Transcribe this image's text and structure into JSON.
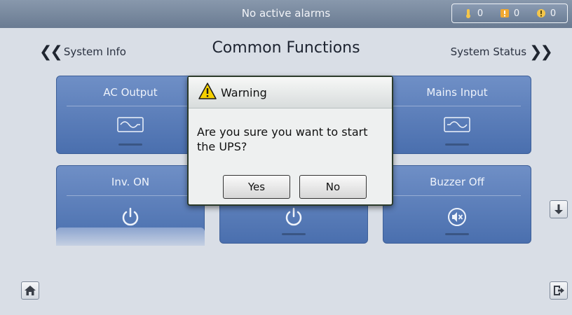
{
  "alarm_bar": {
    "title": "No active alarms",
    "counts": {
      "minor": "0",
      "major": "0",
      "critical": "0"
    }
  },
  "nav": {
    "left_label": "System Info",
    "right_label": "System Status",
    "page_title": "Common Functions"
  },
  "tiles": {
    "ac_output": {
      "label": "AC Output",
      "icon": "sine-wave-icon"
    },
    "mains_input": {
      "label": "Mains Input",
      "icon": "sine-wave-icon"
    },
    "inv_on": {
      "label": "Inv. ON",
      "icon": "power-icon"
    },
    "inv_off": {
      "icon": "power-icon"
    },
    "buzzer_off": {
      "label": "Buzzer Off",
      "icon": "speaker-mute-icon"
    }
  },
  "dialog": {
    "title": "Warning",
    "message": "Are you sure you want to start the UPS?",
    "yes_label": "Yes",
    "no_label": "No"
  },
  "colors": {
    "tile": "#5a7dba",
    "panel": "#d9dee6",
    "topbar": "#7a8ba2",
    "warning": "#f5d000"
  }
}
